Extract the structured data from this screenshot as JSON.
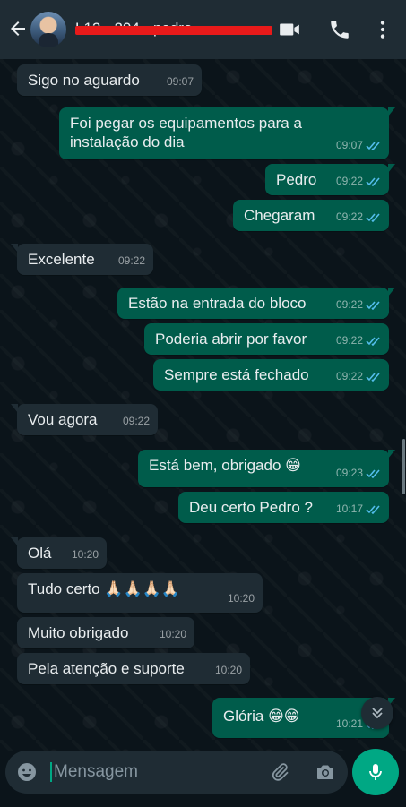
{
  "header": {
    "contact_name": "L12 - 204 - pedro",
    "back_icon": "arrow-left-icon",
    "video_icon": "video-camera-icon",
    "call_icon": "phone-icon",
    "menu_icon": "more-vertical-icon"
  },
  "colors": {
    "header_bg": "#1f2c34",
    "chat_bg": "#0b141a",
    "incoming_bubble": "#1f2c34",
    "outgoing_bubble": "#005c4b",
    "read_ticks": "#53bdeb",
    "accent": "#00a884"
  },
  "messages": [
    {
      "dir": "in",
      "text": "Sigo no aguardo",
      "time": "09:07"
    },
    {
      "dir": "out",
      "text": "Foi pegar os equipamentos para a instalação do dia",
      "time": "09:07",
      "status": "read"
    },
    {
      "dir": "out",
      "text": "Pedro",
      "time": "09:22",
      "status": "read"
    },
    {
      "dir": "out",
      "text": "Chegaram",
      "time": "09:22",
      "status": "read"
    },
    {
      "dir": "in",
      "text": "Excelente",
      "time": "09:22"
    },
    {
      "dir": "out",
      "text": "Estão na entrada do bloco",
      "time": "09:22",
      "status": "read"
    },
    {
      "dir": "out",
      "text": "Poderia abrir por favor",
      "time": "09:22",
      "status": "read"
    },
    {
      "dir": "out",
      "text": "Sempre está fechado",
      "time": "09:22",
      "status": "read"
    },
    {
      "dir": "in",
      "text": "Vou agora",
      "time": "09:22"
    },
    {
      "dir": "out",
      "text": "Está bem, obrigado 😁",
      "time": "09:23",
      "status": "read"
    },
    {
      "dir": "out",
      "text": "Deu certo Pedro ?",
      "time": "10:17",
      "status": "read"
    },
    {
      "dir": "in",
      "text": "Olá",
      "time": "10:20"
    },
    {
      "dir": "in",
      "text": "Tudo certo 🙏🏻🙏🏻🙏🏻🙏🏻",
      "time": "10:20"
    },
    {
      "dir": "in",
      "text": "Muito obrigado",
      "time": "10:20"
    },
    {
      "dir": "in",
      "text": "Pela atenção e suporte",
      "time": "10:20"
    },
    {
      "dir": "out",
      "text": "Glória 😁😁",
      "time": "10:21",
      "status": "read"
    }
  ],
  "composer": {
    "placeholder": "Mensagem",
    "emoji_icon": "emoji-smile-icon",
    "attach_icon": "paperclip-icon",
    "camera_icon": "camera-icon",
    "mic_icon": "microphone-icon"
  },
  "scroll_down_icon": "chevrons-down-icon"
}
